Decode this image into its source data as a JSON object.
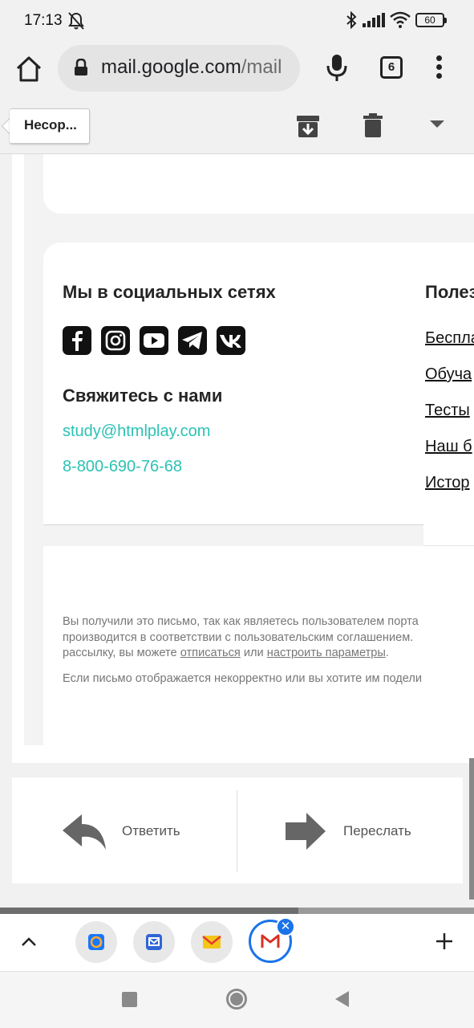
{
  "status_bar": {
    "time": "17:13",
    "battery": "60"
  },
  "browser": {
    "url_host": "mail.google.com",
    "url_path": "/mail",
    "tab_count": "6"
  },
  "toolbar": {
    "back_label": "Несор..."
  },
  "email": {
    "social_heading": "Мы в социальных сетях",
    "social_icons": [
      "facebook-icon",
      "instagram-icon",
      "youtube-icon",
      "telegram-icon",
      "vk-icon"
    ],
    "contact_heading": "Свяжитесь с нами",
    "contact_email": "study@htmlplay.com",
    "contact_phone": "8-800-690-76-68",
    "useful_heading": "Полез",
    "useful_links": [
      "Беспла",
      "Обуча",
      "Тесты",
      "Наш б",
      "Истор"
    ],
    "legal_line1": "Вы получили это письмо, так как являетесь пользователем порта",
    "legal_line2": "производится в соответствии с пользовательским соглашением.",
    "legal_line3_start": "рассылку, вы можете",
    "unsubscribe_link": "отписаться",
    "legal_line3_mid": "или",
    "settings_link": "настроить параметры",
    "legal_line3_end": ".",
    "legal_note": "Если письмо отображается некорректно или вы хотите им подели"
  },
  "actions": {
    "reply": "Ответить",
    "forward": "Переслать"
  },
  "colors": {
    "accent_teal": "#2cc2b5",
    "tab_active_blue": "#1a73e8"
  }
}
